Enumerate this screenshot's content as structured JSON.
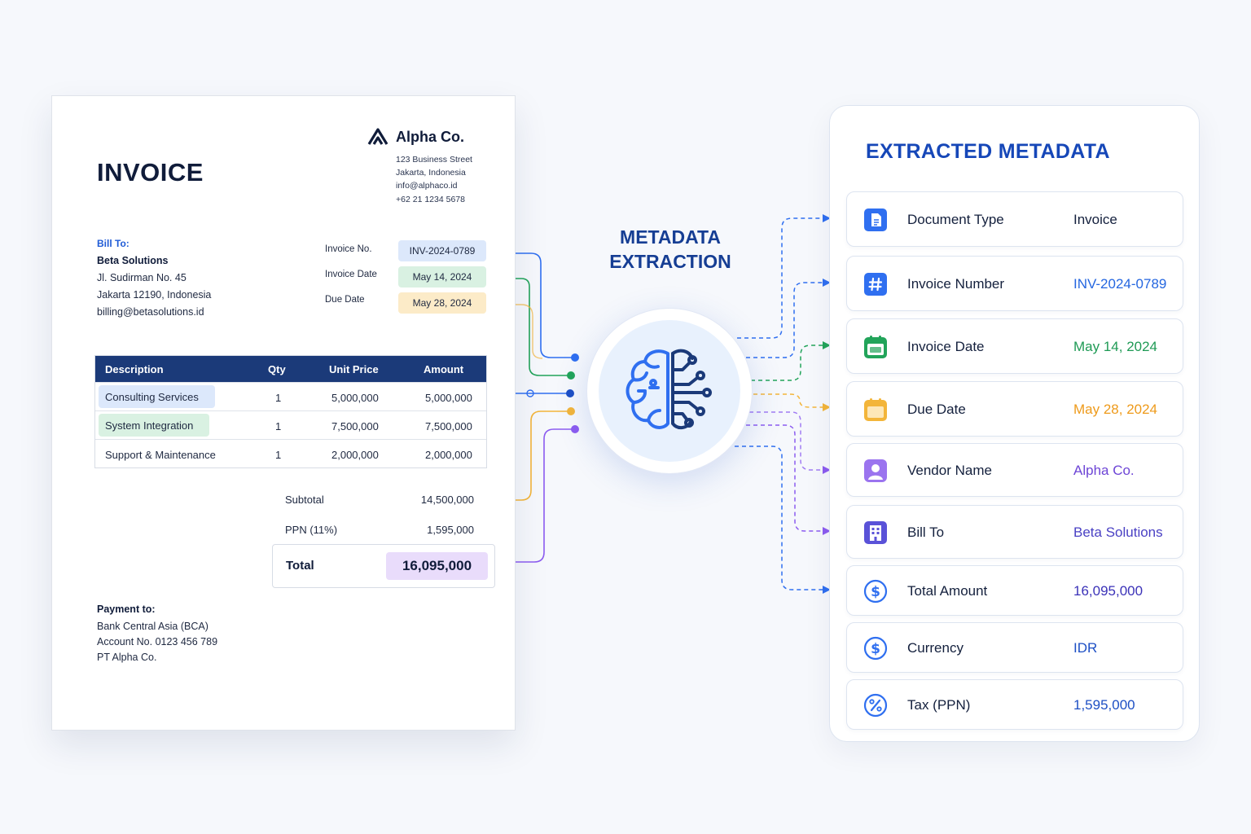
{
  "invoice": {
    "title": "INVOICE",
    "company": {
      "name": "Alpha Co.",
      "address_lines": [
        "123 Business Street",
        "Jakarta, Indonesia",
        "info@alphaco.id",
        "+62 21 1234 5678"
      ]
    },
    "bill_to": {
      "label": "Bill To:",
      "name": "Beta Solutions",
      "lines": [
        "Jl. Sudirman No. 45",
        "Jakarta 12190, Indonesia",
        "billing@betasolutions.id"
      ]
    },
    "meta": [
      {
        "label": "Invoice No.",
        "value": "INV-2024-0789",
        "color": "#dce8fb"
      },
      {
        "label": "Invoice Date",
        "value": "May 14, 2024",
        "color": "#d9f1e2"
      },
      {
        "label": "Due Date",
        "value": "May 28, 2024",
        "color": "#fcebc8"
      }
    ],
    "table": {
      "headers": [
        "Description",
        "Qty",
        "Unit Price",
        "Amount"
      ],
      "rows": [
        {
          "description": "Consulting Services",
          "qty": "1",
          "unit_price": "5,000,000",
          "amount": "5,000,000",
          "highlight": "#dce8fb"
        },
        {
          "description": "System Integration",
          "qty": "1",
          "unit_price": "7,500,000",
          "amount": "7,500,000",
          "highlight": "#d9f1e2"
        },
        {
          "description": "Support & Maintenance",
          "qty": "1",
          "unit_price": "2,000,000",
          "amount": "2,000,000",
          "highlight": ""
        }
      ]
    },
    "summary": {
      "subtotal_label": "Subtotal",
      "subtotal_value": "14,500,000",
      "tax_label": "PPN (11%)",
      "tax_value": "1,595,000",
      "total_label": "Total",
      "total_value": "16,095,000"
    },
    "payment": {
      "label": "Payment to:",
      "lines": [
        "Bank Central Asia (BCA)",
        "Account No. 0123 456 789",
        "PT Alpha Co."
      ]
    }
  },
  "center": {
    "title_line1": "METADATA",
    "title_line2": "EXTRACTION",
    "icon": "brain-circuit-icon"
  },
  "panel": {
    "title": "EXTRACTED METADATA",
    "items": [
      {
        "label": "Document Type",
        "value": "Invoice",
        "icon": "document-icon",
        "value_color": "#14203d"
      },
      {
        "label": "Invoice Number",
        "value": "INV-2024-0789",
        "icon": "hash-icon",
        "value_color": "#2466e0"
      },
      {
        "label": "Invoice Date",
        "value": "May 14, 2024",
        "icon": "calendar-icon",
        "value_color": "#1f9a55"
      },
      {
        "label": "Due Date",
        "value": "May 28, 2024",
        "icon": "calendar-icon",
        "value_color": "#ee9a1a"
      },
      {
        "label": "Vendor Name",
        "value": "Alpha Co.",
        "icon": "user-icon",
        "value_color": "#6d45d6"
      },
      {
        "label": "Bill To",
        "value": "Beta Solutions",
        "icon": "building-icon",
        "value_color": "#4a41c4"
      },
      {
        "label": "Total Amount",
        "value": "16,095,000",
        "icon": "dollar-icon",
        "value_color": "#3b32b8"
      },
      {
        "label": "Currency",
        "value": "IDR",
        "icon": "dollar-icon",
        "value_color": "#1d4fc4"
      },
      {
        "label": "Tax (PPN)",
        "value": "1,595,000",
        "icon": "percent-icon",
        "value_color": "#1d4fc4"
      }
    ]
  },
  "colors": {
    "blue": "#2f6ff0",
    "green": "#22a45a",
    "yellow": "#f3b53a",
    "purple": "#8c5cf0",
    "navy": "#1b3a79"
  }
}
